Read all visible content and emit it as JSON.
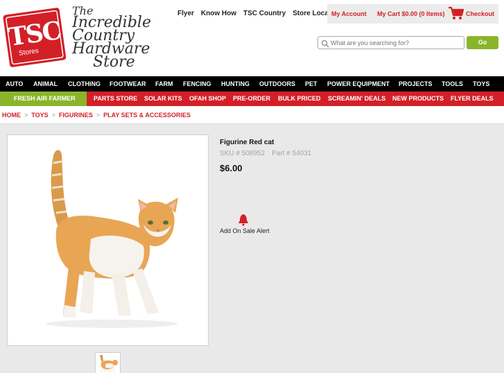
{
  "brand": {
    "logo_line1": "TSC",
    "logo_line2": "Stores",
    "tagline_line1": "The",
    "tagline_line2": "Incredible",
    "tagline_line3": "Country",
    "tagline_line4": "Hardware",
    "tagline_line5": "Store",
    "colors": {
      "red": "#d32027",
      "green": "#8ab52a",
      "black": "#000000"
    }
  },
  "utility_links": [
    "Flyer",
    "Know How",
    "TSC Country",
    "Store Locator"
  ],
  "account": {
    "my_account": "My Account",
    "my_cart": "My Cart $0.00 (0 Items)",
    "checkout": "Checkout",
    "cart_icon": "shopping-cart-icon"
  },
  "search": {
    "placeholder": "What are you searching for?",
    "value": "",
    "go_label": "Go",
    "icon": "search-icon"
  },
  "nav_main": [
    "AUTO",
    "ANIMAL",
    "CLOTHING",
    "FOOTWEAR",
    "FARM",
    "FENCING",
    "HUNTING",
    "OUTDOORS",
    "PET",
    "POWER EQUIPMENT",
    "PROJECTS",
    "TOOLS",
    "TOYS"
  ],
  "nav_sub": {
    "highlight": "FRESH AIR FARMER",
    "items": [
      "PARTS STORE",
      "SOLAR KITS",
      "OFAH SHOP",
      "PRE-ORDER",
      "BULK PRICED",
      "SCREAMIN' DEALS",
      "NEW PRODUCTS",
      "FLYER DEALS"
    ]
  },
  "breadcrumb": [
    "HOME",
    "TOYS",
    "FIGURINES",
    "PLAY SETS & ACCESSORIES"
  ],
  "breadcrumb_separator": ">",
  "product": {
    "title": "Figurine Red cat",
    "sku": "SKU # 508952",
    "part": "Part # 54031",
    "price": "$6.00",
    "sale_alert": "Add On Sale Alert",
    "sale_alert_icon": "bell-icon"
  }
}
